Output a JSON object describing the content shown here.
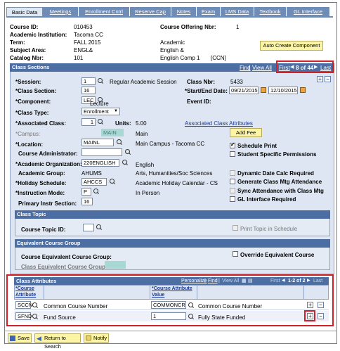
{
  "tabs": [
    "Basic Data",
    "Meetings",
    "Enrollment Cntrl",
    "Reserve Cap",
    "Notes",
    "Exam",
    "LMS Data",
    "Textbook",
    "GL Interface"
  ],
  "header": {
    "course_id_label": "Course ID:",
    "course_id": "010453",
    "institution_label": "Academic Institution:",
    "institution": "Tacoma CC",
    "term_label": "Term:",
    "term": "FALL 2015",
    "subject_label": "Subject Area:",
    "subject": "ENGL&",
    "catalog_label": "Catalog Nbr:",
    "catalog": "101",
    "offering_label": "Course Offering Nbr:",
    "offering": "1",
    "career": "Academic",
    "subject_desc": "English &",
    "catalog_desc": "English Comp 1",
    "catalog_flag": "[CCN]",
    "auto_create_btn": "Auto Create Component"
  },
  "class_sections": {
    "title": "Class Sections",
    "find": "Find",
    "view_all": "View All",
    "first": "First",
    "pager": "8 of 44",
    "last": "Last",
    "session_label": "*Session:",
    "session": "1",
    "session_desc": "Regular Academic Session",
    "class_nbr_label": "Class Nbr:",
    "class_nbr": "5433",
    "class_section_label": "*Class Section:",
    "class_section": "16",
    "dates_label": "*Start/End Date:",
    "start_date": "09/21/2015",
    "end_date": "12/10/2015",
    "component_label": "*Component:",
    "component": "LEC",
    "component_desc": "Lecture",
    "event_label": "Event ID:",
    "class_type_label": "*Class Type:",
    "class_type": "Enrollment",
    "assoc_class_label": "*Associated Class:",
    "assoc_class": "1",
    "units_label": "Units:",
    "units": "5.00",
    "assoc_attr_link": "Associated Class Attributes",
    "campus_label": "*Campus:",
    "campus": "MAIN",
    "campus_desc": "Main",
    "add_fee_btn": "Add Fee",
    "location_label": "*Location:",
    "location": "MAINL",
    "location_desc": "Main Campus - Tacoma CC",
    "schedule_print": "Schedule Print",
    "student_specific": "Student Specific Permissions",
    "course_admin_label": "Course Administrator:",
    "acad_org_label": "*Academic Organization:",
    "acad_org": "220ENGLISH",
    "acad_org_desc": "English",
    "acad_group_label": "Academic Group:",
    "acad_group": "AHUMS",
    "acad_group_desc": "Arts, Humanities/Soc Sciences",
    "dyn_date": "Dynamic Date Calc Required",
    "holiday_label": "*Holiday Schedule:",
    "holiday": "AHCCS",
    "holiday_desc": "Academic Holiday Calendar - CS",
    "gen_mtg": "Generate Class Mtg Attendance",
    "instr_mode_label": "*Instruction Mode:",
    "instr_mode": "P",
    "instr_mode_desc": "In Person",
    "sync_att": "Sync Attendance with Class Mtg",
    "primary_sec_label": "Primary Instr Section:",
    "primary_sec": "16",
    "gl_interface": "GL Interface Required"
  },
  "class_topic": {
    "title": "Class Topic",
    "topic_label": "Course Topic ID:",
    "print_topic": "Print Topic in Schedule"
  },
  "equiv": {
    "title": "Equivalent Course Group",
    "group_label": "Course Equivalent Course Group:",
    "class_group_label": "Class Equivalent Course Group:",
    "override": "Override Equivalent Course"
  },
  "class_attributes": {
    "title": "Class Attributes",
    "personalize": "Personalize",
    "find": "Find",
    "view_all": "View All",
    "first": "First",
    "pager": "1-2 of 2",
    "last": "Last",
    "col_attr_1": "*Course",
    "col_attr_2": "Attribute",
    "col_val_1": "*Course Attribute",
    "col_val_2": "Value",
    "rows": [
      {
        "attr": "SCCN",
        "attr_desc": "Common Course Number",
        "value": "COMMONCRS",
        "value_desc": "Common Course Number"
      },
      {
        "attr": "SFND",
        "attr_desc": "Fund Source",
        "value": "1",
        "value_desc": "Fully State Funded"
      }
    ]
  },
  "footer": {
    "save": "Save",
    "return": "Return to Search",
    "notify": "Notify"
  }
}
